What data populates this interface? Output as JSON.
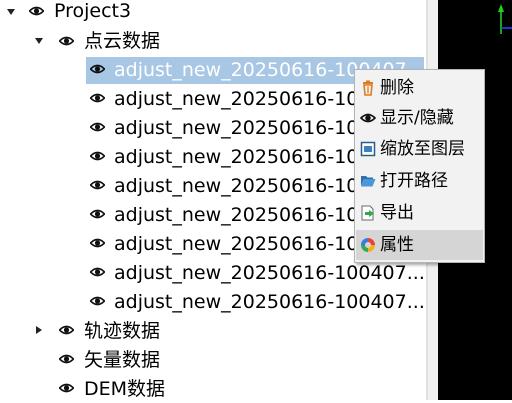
{
  "tree": {
    "project": {
      "label": "Project3",
      "expanded": true
    },
    "groups": [
      {
        "label": "点云数据",
        "expanded": true
      },
      {
        "label": "轨迹数据",
        "expanded": false
      },
      {
        "label": "矢量数据"
      },
      {
        "label": "DEM数据"
      }
    ],
    "pointclouds": [
      {
        "label": "adjust_new_20250616-100407...",
        "selected": true
      },
      {
        "label": "adjust_new_20250616-100407..."
      },
      {
        "label": "adjust_new_20250616-100407..."
      },
      {
        "label": "adjust_new_20250616-100407..."
      },
      {
        "label": "adjust_new_20250616-100407..."
      },
      {
        "label": "adjust_new_20250616-100407..."
      },
      {
        "label": "adjust_new_20250616-100407..."
      },
      {
        "label": "adjust_new_20250616-100407..."
      },
      {
        "label": "adjust_new_20250616-100407..."
      }
    ]
  },
  "context_menu": {
    "items": [
      {
        "label": "删除",
        "icon": "trash-icon"
      },
      {
        "label": "显示/隐藏",
        "icon": "eye-icon"
      },
      {
        "label": "缩放至图层",
        "icon": "zoom-to-layer-icon"
      },
      {
        "label": "打开路径",
        "icon": "folder-open-icon"
      },
      {
        "label": "导出",
        "icon": "export-icon"
      },
      {
        "label": "属性",
        "icon": "properties-icon",
        "hovered": true
      }
    ]
  },
  "colors": {
    "selection": "#a7c7e4",
    "menu_bg": "#f2f2f2",
    "menu_hover": "#d5d5d5",
    "viewport_bg": "#000000"
  }
}
